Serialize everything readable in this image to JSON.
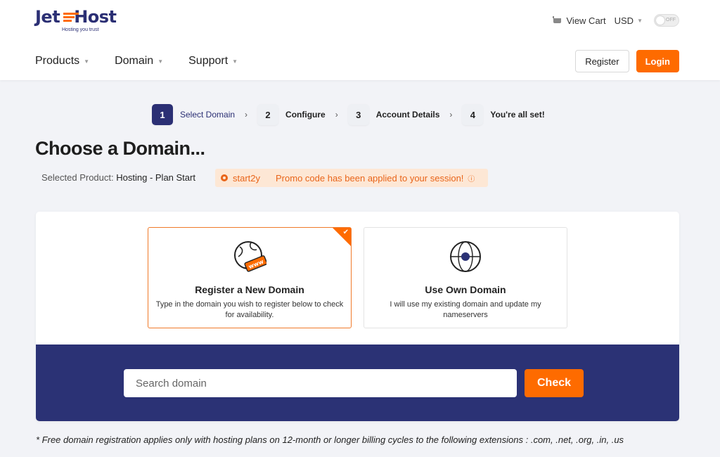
{
  "brand": {
    "name_left": "Jet",
    "name_right": "Host",
    "tagline": "Hosting you trust",
    "accent": "#fe6b00",
    "primary": "#2b2f74"
  },
  "topbar": {
    "cart_label": "View Cart",
    "cart_icon": "cart-icon",
    "currency": "USD",
    "toggle_label": "OFF"
  },
  "nav": {
    "items": [
      {
        "label": "Products"
      },
      {
        "label": "Domain"
      },
      {
        "label": "Support"
      }
    ]
  },
  "auth": {
    "register_label": "Register",
    "login_label": "Login"
  },
  "steps": [
    {
      "num": "1",
      "label": "Select Domain",
      "active": true
    },
    {
      "num": "2",
      "label": "Configure"
    },
    {
      "num": "3",
      "label": "Account Details"
    },
    {
      "num": "4",
      "label": "You're all set!"
    }
  ],
  "page": {
    "title": "Choose a Domain..."
  },
  "selected_product": {
    "label": "Selected Product:",
    "value": "Hosting - Plan Start"
  },
  "promo": {
    "code": "start2y",
    "message": "Promo code has been applied to your session!"
  },
  "options": {
    "register": {
      "title": "Register a New Domain",
      "desc": "Type in the domain you wish to register below to check for availability.",
      "icon": "globe-www-icon",
      "selected": true
    },
    "own": {
      "title": "Use Own Domain",
      "desc": "I will use my existing domain and update my nameservers",
      "icon": "globe-icon"
    }
  },
  "search": {
    "placeholder": "Search domain",
    "button_label": "Check"
  },
  "footnote": "* Free domain registration applies only with hosting plans on 12-month or longer billing cycles to the following extensions : .com, .net, .org, .in, .us"
}
